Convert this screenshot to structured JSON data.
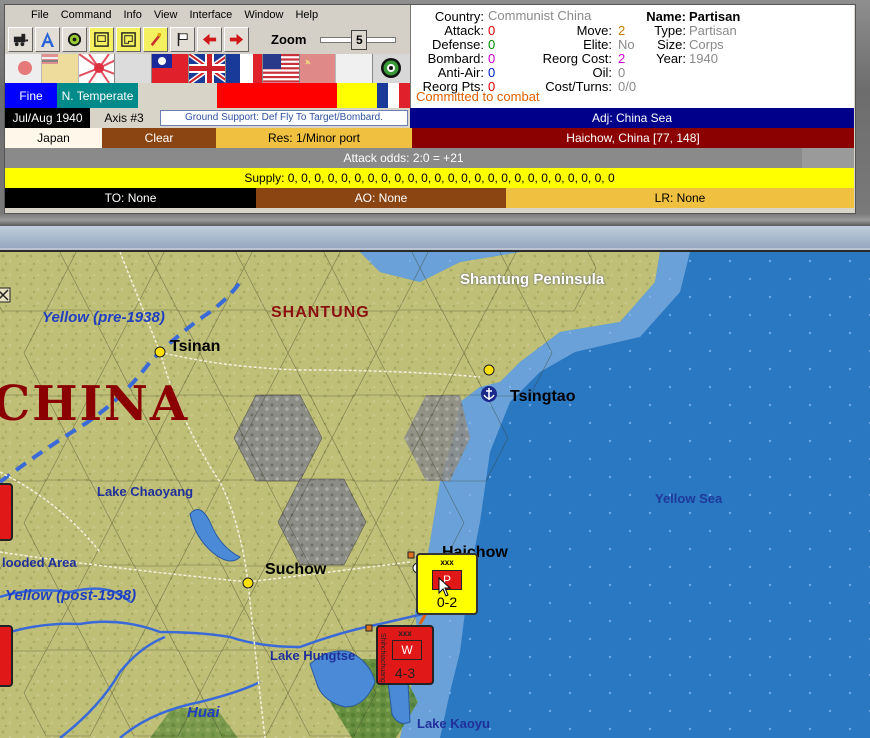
{
  "menu": [
    "File",
    "Command",
    "Info",
    "View",
    "Interface",
    "Window",
    "Help"
  ],
  "toolbar": {
    "buttons": [
      "train-icon",
      "air-letter-icon",
      "supply-icon",
      "unit-frame-icon",
      "unit-frame-alt-icon",
      "partisan-icon",
      "flag-icon",
      "arrow-left-icon",
      "arrow-right-icon"
    ],
    "zoom_label": "Zoom",
    "zoom_value": "5"
  },
  "flags": [
    "japan-pale",
    "manchukuo-pale",
    "rising-sun-pale",
    "china-blank",
    "nationalist-china",
    "britain",
    "france",
    "usa",
    "ussr",
    "blank",
    "target"
  ],
  "weather": {
    "condition": "Fine",
    "zone": "N. Temperate",
    "condition_color": "#0000ff",
    "zone_color": "#008a8a"
  },
  "info": {
    "country_label": "Country:",
    "country_value": "Communist China",
    "attack_label": "Attack:",
    "attack_value": "0",
    "defense_label": "Defense:",
    "defense_value": "0",
    "bombard_label": "Bombard:",
    "bombard_value": "0",
    "antiair_label": "Anti-Air:",
    "antiair_value": "0",
    "reorg_pts_label": "Reorg Pts:",
    "reorg_pts_value": "0",
    "move_label": "Move:",
    "move_value": "2",
    "elite_label": "Elite:",
    "elite_value": "No",
    "reorg_cost_label": "Reorg Cost:",
    "reorg_cost_value": "2",
    "oil_label": "Oil:",
    "oil_value": "0",
    "cost_turns_label": "Cost/Turns:",
    "cost_turns_value": "0/0",
    "name_label": "Name:",
    "name_value": "Partisan",
    "type_label": "Type:",
    "type_value": "Partisan",
    "size_label": "Size:",
    "size_value": "Corps",
    "year_label": "Year:",
    "year_value": "1940",
    "status": "Committed to combat"
  },
  "date_row": {
    "date": "Jul/Aug 1940",
    "axis": "Axis #3",
    "ground_support": "Ground Support: Def Fly To Target/Bombard.",
    "adjacent": "Adj: China Sea"
  },
  "terrain_row": {
    "owner": "Japan",
    "terrain": "Clear",
    "resource": "Res: 1/Minor port",
    "location": "Haichow, China [77, 148]"
  },
  "attack_odds": "Attack odds: 2:0 = +21",
  "supply": "Supply: 0, 0, 0, 0, 0, 0, 0, 0, 0, 0, 0, 0, 0, 0, 0, 0, 0, 0, 0, 0, 0, 0, 0, 0, 0",
  "zones": {
    "to": "TO: None",
    "ao": "AO: None",
    "lr": "LR: None"
  },
  "map": {
    "region": "SHANTUNG",
    "country": "CHINA",
    "peninsula": "Shantung Peninsula",
    "river_pre": "Yellow (pre-1938)",
    "river_post": "Yellow (post-1938)",
    "river_huai": "Huai",
    "lake_chaoyang": "Lake Chaoyang",
    "lake_hungtse": "Lake Hungtse",
    "lake_kaoyu": "Lake Kaoyu",
    "flooded_area": "looded Area",
    "sea": "Yellow Sea",
    "cities": [
      "Tsinan",
      "Tsingtao",
      "Suchow",
      "Haichow"
    ]
  },
  "counters": {
    "partisan": {
      "size": "xxx",
      "symbol": "P",
      "strength": "0-2"
    },
    "chinese": {
      "size": "xxx",
      "symbol": "W",
      "strength": "4-3",
      "side_label": "Shihchiachuang"
    }
  }
}
